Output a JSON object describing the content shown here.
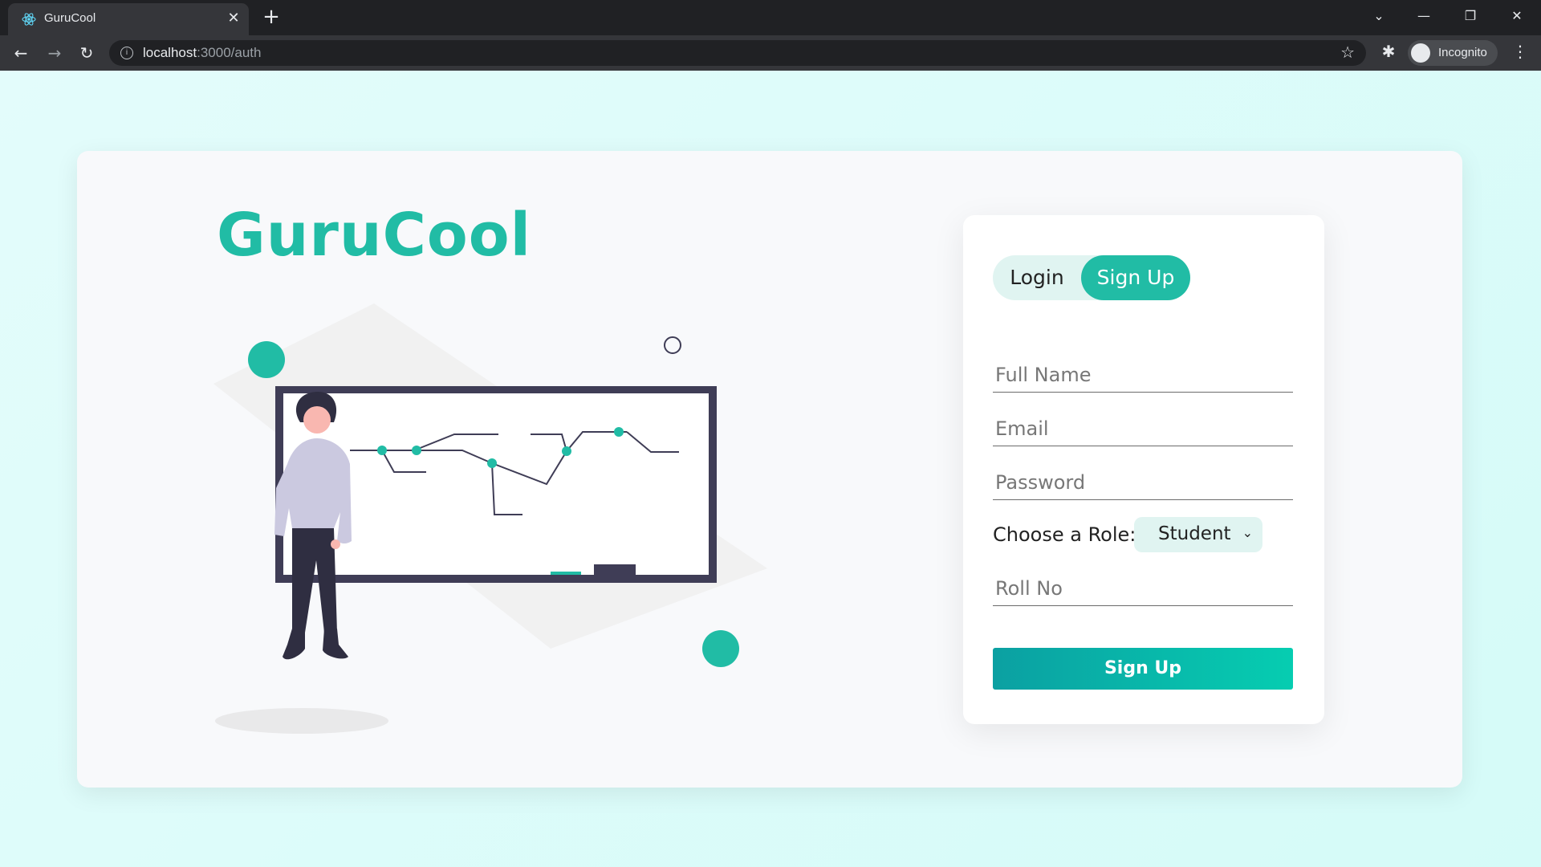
{
  "browser": {
    "tab_title": "GuruCool",
    "url_host": "localhost",
    "url_path": ":3000/auth",
    "profile_label": "Incognito",
    "icons": [
      "react-favicon",
      "close-icon",
      "plus-icon",
      "back-icon",
      "forward-icon",
      "reload-icon",
      "info-icon",
      "star-icon",
      "extensions-icon",
      "incognito-icon",
      "menu-icon",
      "minimize-icon",
      "restore-icon",
      "window-close-icon",
      "tab-search-icon"
    ]
  },
  "app": {
    "brand": "GuruCool",
    "accent_color": "#21bca5"
  },
  "auth": {
    "tabs": {
      "login": "Login",
      "signup": "Sign Up",
      "active": "signup"
    },
    "fields": {
      "full_name_placeholder": "Full Name",
      "email_placeholder": "Email",
      "password_placeholder": "Password",
      "roll_no_placeholder": "Roll No"
    },
    "role": {
      "label": "Choose a Role:",
      "selected": "Student"
    },
    "submit_label": "Sign Up"
  }
}
